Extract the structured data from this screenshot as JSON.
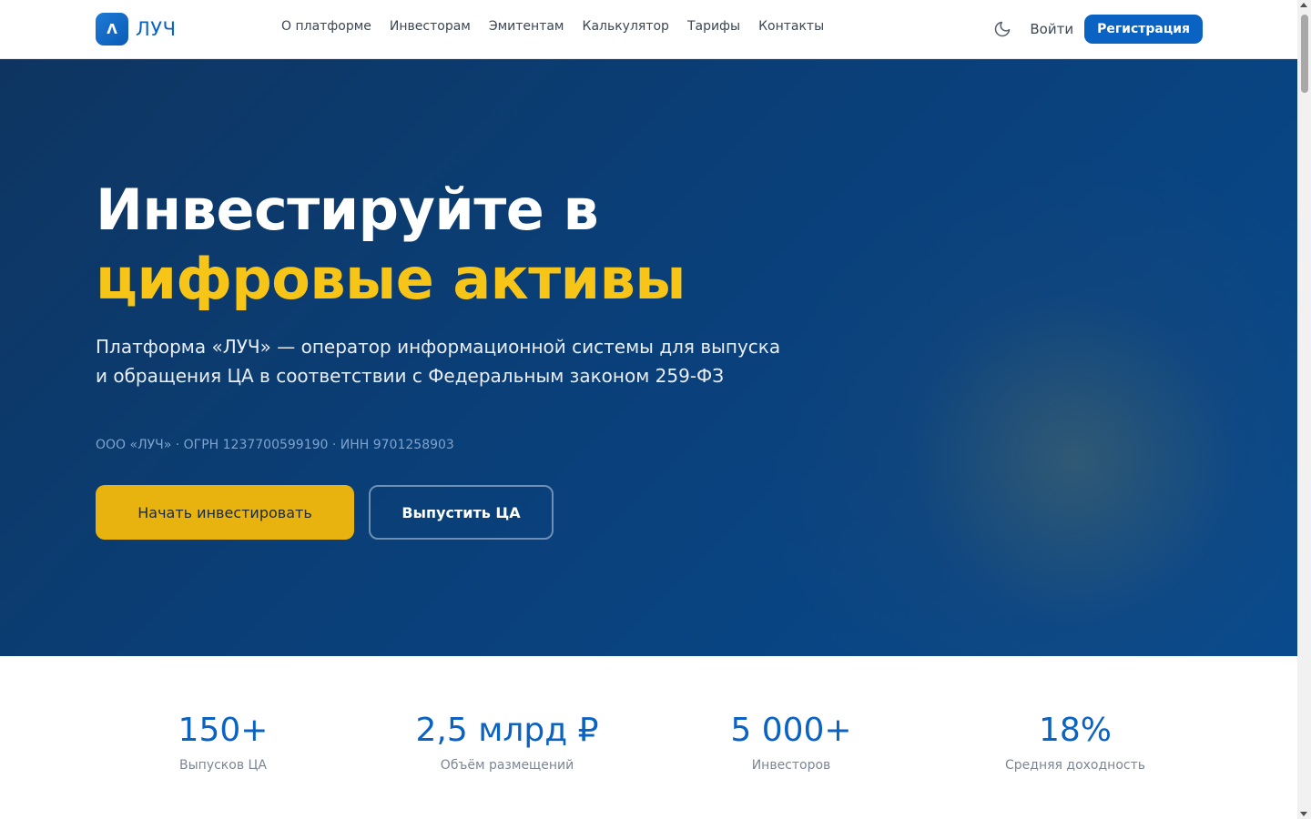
{
  "header": {
    "logo_mark": "Λ",
    "logo_text": "ЛУЧ",
    "nav": [
      {
        "label": "О платформе"
      },
      {
        "label": "Инвесторам"
      },
      {
        "label": "Эмитентам"
      },
      {
        "label": "Калькулятор"
      },
      {
        "label": "Тарифы"
      },
      {
        "label": "Контакты"
      }
    ],
    "theme_toggle_icon": "moon-icon",
    "login_label": "Войти",
    "register_label": "Регистрация"
  },
  "hero": {
    "title_line1": "Инвестируйте в",
    "title_line2": "цифровые активы",
    "subtitle": "Платформа «ЛУЧ» — оператор информационной системы для выпуска и обращения ЦА в соответствии с Федеральным законом 259-ФЗ",
    "legal": "ООО «ЛУЧ» · ОГРН 1237700599190 · ИНН 9701258903",
    "primary_cta": "Начать инвестировать",
    "secondary_cta": "Выпустить ЦА"
  },
  "stats": [
    {
      "value": "150+",
      "label": "Выпусков ЦА"
    },
    {
      "value": "2,5 млрд ₽",
      "label": "Объём размещений"
    },
    {
      "value": "5 000+",
      "label": "Инвесторов"
    },
    {
      "value": "18%",
      "label": "Средняя доходность"
    }
  ],
  "colors": {
    "brand_blue": "#0a63c2",
    "accent_yellow": "#f6c518",
    "cta_yellow": "#e8b30e",
    "hero_bg": "#0a3f78"
  }
}
